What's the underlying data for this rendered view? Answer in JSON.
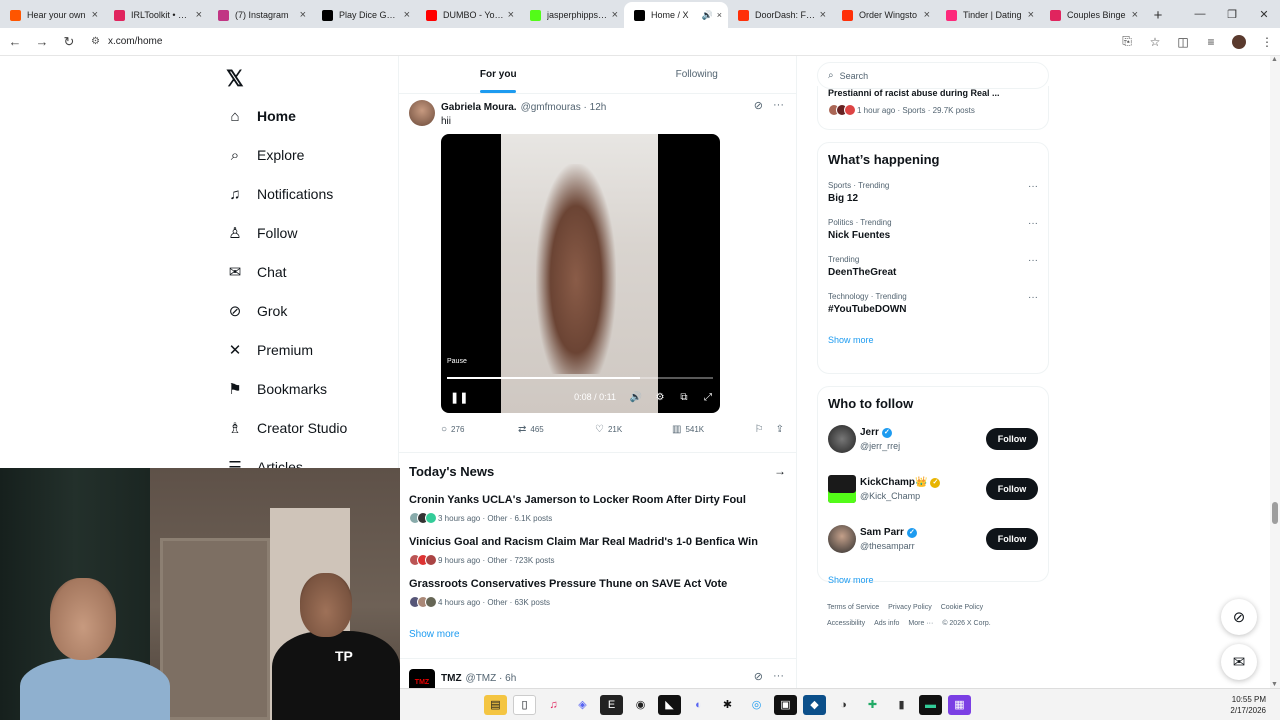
{
  "browser": {
    "tabs": [
      {
        "title": "Hear your own",
        "color": "#ff5500"
      },
      {
        "title": "IRLToolkit • Das",
        "color": "#e0245e"
      },
      {
        "title": "(7) Instagram",
        "color": "#c13584"
      },
      {
        "title": "Play Dice Gamb",
        "color": "#000000"
      },
      {
        "title": "DUMBO - YouT",
        "color": "#ff0000"
      },
      {
        "title": "jasperphipps St",
        "color": "#53fc18"
      },
      {
        "title": "Home / X",
        "color": "#000000"
      },
      {
        "title": "DoorDash: Foo",
        "color": "#ff3008"
      },
      {
        "title": "Order Wingsto",
        "color": "#ff3008"
      },
      {
        "title": "Tinder | Dating",
        "color": "#fd297b"
      },
      {
        "title": "Couples Binge",
        "color": "#e0245e"
      }
    ],
    "new_tab": "+",
    "url": "x.com/home"
  },
  "nav": {
    "logo": "𝕏",
    "items": [
      {
        "label": "Home",
        "icon": "⌂"
      },
      {
        "label": "Explore",
        "icon": "⌕"
      },
      {
        "label": "Notifications",
        "icon": "🔔"
      },
      {
        "label": "Follow",
        "icon": "👤"
      },
      {
        "label": "Chat",
        "icon": "✉"
      },
      {
        "label": "Grok",
        "icon": "⊘"
      },
      {
        "label": "Premium",
        "icon": "𝕏"
      },
      {
        "label": "Bookmarks",
        "icon": "🔖"
      },
      {
        "label": "Creator Studio",
        "icon": "♙"
      },
      {
        "label": "Articles",
        "icon": "☰"
      }
    ]
  },
  "feed": {
    "tabs": [
      "For you",
      "Following"
    ],
    "post": {
      "name": "Gabriela Moura.",
      "handle": "@gmfmouras · 12h",
      "text": "hii",
      "video": {
        "label": "Pause",
        "time": "0:08 / 0:11",
        "progress": 0.727
      },
      "replies": "276",
      "reposts": "465",
      "likes": "21K",
      "views": "541K"
    },
    "news": {
      "title": "Today's News",
      "items": [
        {
          "headline": "Cronin Yanks UCLA's Jamerson to Locker Room After Dirty Foul",
          "meta": "3 hours ago · Other · 6.1K posts"
        },
        {
          "headline": "Vinícius Goal and Racism Claim Mar Real Madrid's 1-0 Benfica Win",
          "meta": "9 hours ago · Other · 723K posts"
        },
        {
          "headline": "Grassroots Conservatives Pressure Thune on SAVE Act Vote",
          "meta": "4 hours ago · Other · 63K posts"
        }
      ],
      "show_more": "Show more"
    },
    "next_post": {
      "name": "TMZ",
      "handle": "@TMZ · 6h",
      "avatar_text": "TMZ"
    }
  },
  "right": {
    "search_placeholder": "Search",
    "top_item": {
      "title": "Prestianni of racist abuse during Real ...",
      "meta": "1 hour ago · Sports · 29.7K posts"
    },
    "happening": {
      "title": "What’s happening",
      "trends": [
        {
          "context": "Sports · Trending",
          "name": "Big 12"
        },
        {
          "context": "Politics · Trending",
          "name": "Nick Fuentes"
        },
        {
          "context": "Trending",
          "name": "DeenTheGreat"
        },
        {
          "context": "Technology · Trending",
          "name": "#YouTubeDOWN"
        }
      ],
      "show_more": "Show more"
    },
    "who_to_follow": {
      "title": "Who to follow",
      "users": [
        {
          "name": "Jerr",
          "handle": "@jerr_rrej",
          "button": "Follow"
        },
        {
          "name": "KickChamp👑",
          "handle": "@Kick_Champ",
          "button": "Follow"
        },
        {
          "name": "Sam Parr",
          "handle": "@thesamparr",
          "button": "Follow"
        }
      ],
      "show_more": "Show more"
    },
    "footer": [
      "Terms of Service",
      "Privacy Policy",
      "Cookie Policy",
      "Accessibility",
      "Ads info",
      "More ···",
      "© 2026 X Corp."
    ]
  },
  "taskbar": {
    "time": "10:55 PM",
    "date": "2/17/2026"
  }
}
